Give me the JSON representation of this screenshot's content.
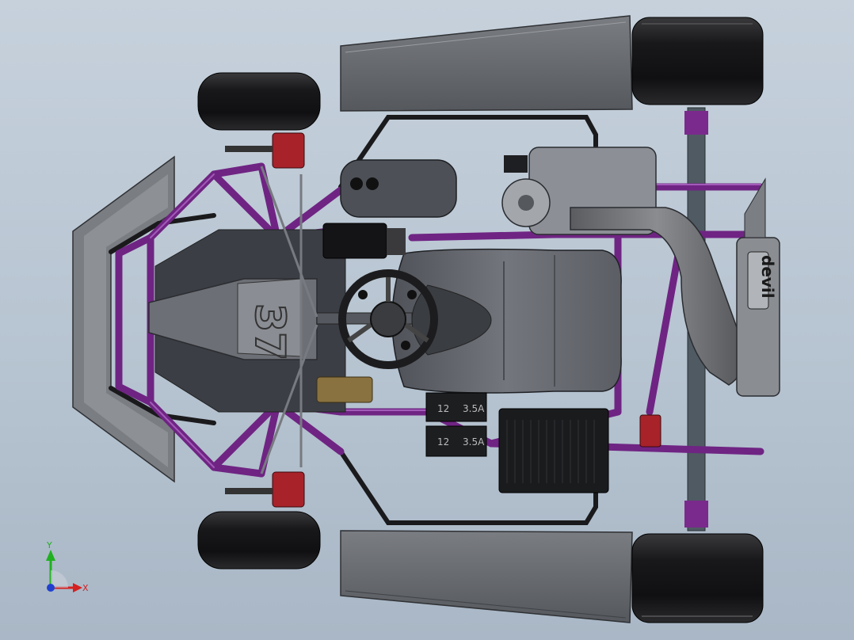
{
  "viewport": {
    "name": "3D model viewport - go-kart top view"
  },
  "labels": {
    "seat_number": "37",
    "exhaust_brand": "devil",
    "battery_1_voltage": "12",
    "battery_1_amps": "3.5A",
    "battery_2_voltage": "12",
    "battery_2_amps": "3.5A"
  },
  "triad": {
    "y_label": "Y",
    "x_label": "X"
  },
  "colors": {
    "background_top": "#c6d1dc",
    "background_bottom": "#a9b7c6",
    "frame": "#7b2a8c",
    "tyre": "#1c1c1e",
    "bodywork": "#6a6d72",
    "seat": "#5a5d63",
    "brake_caliper": "#a8222a",
    "axis_x": "#d42020",
    "axis_y": "#20b020",
    "axis_z": "#2040d0"
  }
}
